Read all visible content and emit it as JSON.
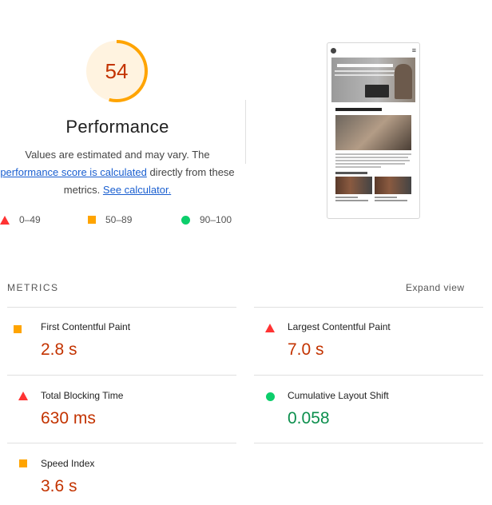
{
  "score": {
    "value": "54",
    "fraction": 0.54,
    "title": "Performance",
    "desc_part1": "Values are estimated and may vary. The ",
    "desc_link1": "performance score is calculated",
    "desc_part2": " directly from these metrics. ",
    "desc_link2": "See calculator.",
    "colors": {
      "ring": "#ffa400",
      "ring_bg": "#fff3e0",
      "text": "#c33300"
    }
  },
  "legend": [
    {
      "shape": "triangle",
      "label": "0–49",
      "color": "#ff3333"
    },
    {
      "shape": "square",
      "label": "50–89",
      "color": "#ffa400"
    },
    {
      "shape": "circle",
      "label": "90–100",
      "color": "#0cce6b"
    }
  ],
  "metrics_section": {
    "label": "METRICS",
    "expand_label": "Expand view"
  },
  "metrics": [
    {
      "name": "First Contentful Paint",
      "value": "2.8 s",
      "rating": "average"
    },
    {
      "name": "Largest Contentful Paint",
      "value": "7.0 s",
      "rating": "fail"
    },
    {
      "name": "Total Blocking Time",
      "value": "630 ms",
      "rating": "fail"
    },
    {
      "name": "Cumulative Layout Shift",
      "value": "0.058",
      "rating": "pass"
    },
    {
      "name": "Speed Index",
      "value": "3.6 s",
      "rating": "average"
    }
  ]
}
